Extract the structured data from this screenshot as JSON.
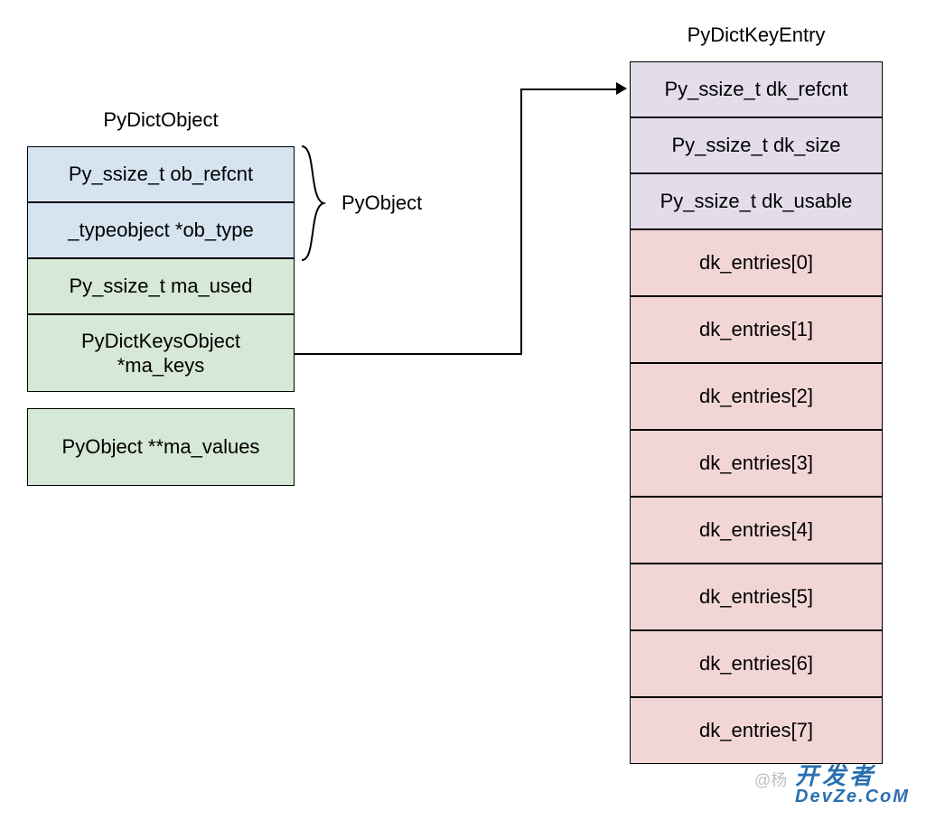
{
  "left": {
    "title": "PyDictObject",
    "fields": [
      {
        "label": "Py_ssize_t ob_refcnt",
        "color": "blue"
      },
      {
        "label": "_typeobject *ob_type",
        "color": "blue"
      },
      {
        "label": "Py_ssize_t ma_used",
        "color": "green"
      },
      {
        "label": "PyDictKeysObject\n*ma_keys",
        "color": "green"
      },
      {
        "label": "PyObject **ma_values",
        "color": "green"
      }
    ],
    "brace_label": "PyObject"
  },
  "right": {
    "title": "PyDictKeyEntry",
    "fields": [
      {
        "label": "Py_ssize_t dk_refcnt",
        "color": "purple"
      },
      {
        "label": "Py_ssize_t dk_size",
        "color": "purple"
      },
      {
        "label": "Py_ssize_t dk_usable",
        "color": "purple"
      },
      {
        "label": "dk_entries[0]",
        "color": "pink"
      },
      {
        "label": "dk_entries[1]",
        "color": "pink"
      },
      {
        "label": "dk_entries[2]",
        "color": "pink"
      },
      {
        "label": "dk_entries[3]",
        "color": "pink"
      },
      {
        "label": "dk_entries[4]",
        "color": "pink"
      },
      {
        "label": "dk_entries[5]",
        "color": "pink"
      },
      {
        "label": "dk_entries[6]",
        "color": "pink"
      },
      {
        "label": "dk_entries[7]",
        "color": "pink"
      }
    ]
  },
  "watermark": {
    "at": "@杨",
    "brand_top": "开发者",
    "brand_bottom": "DevZe.CoM"
  }
}
